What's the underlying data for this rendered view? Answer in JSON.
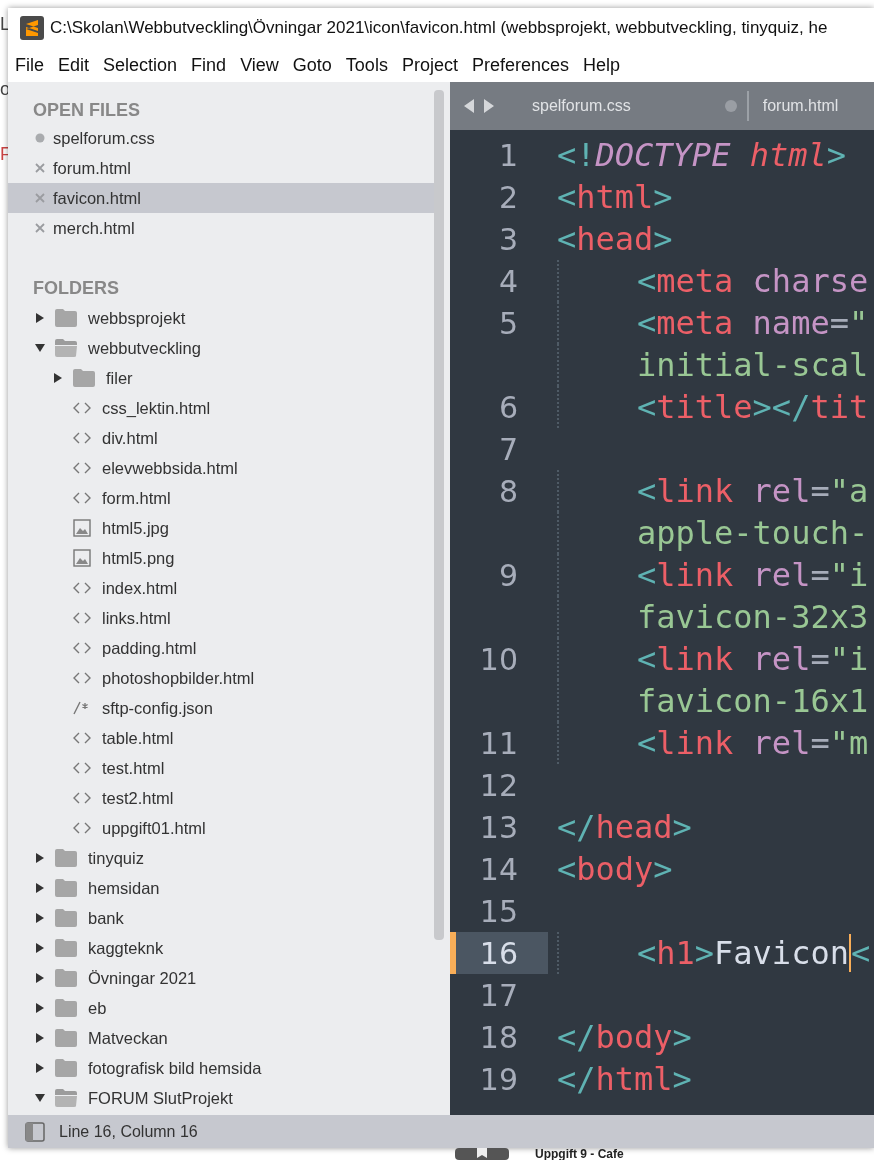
{
  "background": {
    "fragments": [
      "L",
      "o",
      "F"
    ],
    "behind_text": "Uppgift 9 - Cafe"
  },
  "window": {
    "title": "C:\\Skolan\\Webbutveckling\\Övningar 2021\\icon\\favicon.html (webbsprojekt, webbutveckling, tinyquiz, he"
  },
  "menu": [
    "File",
    "Edit",
    "Selection",
    "Find",
    "View",
    "Goto",
    "Tools",
    "Project",
    "Preferences",
    "Help"
  ],
  "sidebar": {
    "open_files_heading": "OPEN FILES",
    "open_files": [
      {
        "name": "spelforum.css",
        "modified": true,
        "selected": false
      },
      {
        "name": "forum.html",
        "modified": false,
        "selected": false
      },
      {
        "name": "favicon.html",
        "modified": false,
        "selected": true
      },
      {
        "name": "merch.html",
        "modified": false,
        "selected": false
      }
    ],
    "folders_heading": "FOLDERS",
    "folders": [
      {
        "name": "webbsprojekt",
        "kind": "folder",
        "expanded": false
      },
      {
        "name": "webbutveckling",
        "kind": "folder",
        "expanded": true,
        "children": [
          {
            "name": "filer",
            "kind": "folder",
            "expanded": false
          },
          {
            "name": "css_lektin.html",
            "kind": "code"
          },
          {
            "name": "div.html",
            "kind": "code"
          },
          {
            "name": "elevwebbsida.html",
            "kind": "code"
          },
          {
            "name": "form.html",
            "kind": "code"
          },
          {
            "name": "html5.jpg",
            "kind": "image"
          },
          {
            "name": "html5.png",
            "kind": "image"
          },
          {
            "name": "index.html",
            "kind": "code"
          },
          {
            "name": "links.html",
            "kind": "code"
          },
          {
            "name": "padding.html",
            "kind": "code"
          },
          {
            "name": "photoshopbilder.html",
            "kind": "code"
          },
          {
            "name": "sftp-config.json",
            "kind": "json"
          },
          {
            "name": "table.html",
            "kind": "code"
          },
          {
            "name": "test.html",
            "kind": "code"
          },
          {
            "name": "test2.html",
            "kind": "code"
          },
          {
            "name": "uppgift01.html",
            "kind": "code"
          }
        ]
      },
      {
        "name": "tinyquiz",
        "kind": "folder",
        "expanded": false
      },
      {
        "name": "hemsidan",
        "kind": "folder",
        "expanded": false
      },
      {
        "name": "bank",
        "kind": "folder",
        "expanded": false
      },
      {
        "name": "kaggteknk",
        "kind": "folder",
        "expanded": false
      },
      {
        "name": "Övningar 2021",
        "kind": "folder",
        "expanded": false
      },
      {
        "name": "eb",
        "kind": "folder",
        "expanded": false
      },
      {
        "name": "Matveckan",
        "kind": "folder",
        "expanded": false
      },
      {
        "name": "fotografisk bild hemsida",
        "kind": "folder",
        "expanded": false
      },
      {
        "name": "FORUM SlutProjekt",
        "kind": "folder",
        "expanded": true
      }
    ]
  },
  "tabs": [
    {
      "name": "spelforum.css",
      "modified": true
    },
    {
      "name": "forum.html",
      "modified": false
    }
  ],
  "editor": {
    "lines": [
      {
        "number": "1",
        "indented": false,
        "current": false,
        "segments": [
          {
            "text": "<!",
            "kind": "punct"
          },
          {
            "text": "DOCTYPE",
            "kind": "doctype"
          },
          {
            "text": " html",
            "kind": "doctype_name"
          },
          {
            "text": ">",
            "kind": "punct"
          }
        ]
      },
      {
        "number": "2",
        "indented": false,
        "current": false,
        "segments": [
          {
            "text": "<",
            "kind": "punct"
          },
          {
            "text": "html",
            "kind": "tag"
          },
          {
            "text": ">",
            "kind": "punct"
          }
        ]
      },
      {
        "number": "3",
        "indented": false,
        "current": false,
        "segments": [
          {
            "text": "<",
            "kind": "punct"
          },
          {
            "text": "head",
            "kind": "tag"
          },
          {
            "text": ">",
            "kind": "punct"
          }
        ]
      },
      {
        "number": "4",
        "indented": true,
        "current": false,
        "segments": [
          {
            "text": "<",
            "kind": "punct"
          },
          {
            "text": "meta",
            "kind": "tag"
          },
          {
            "text": " charse",
            "kind": "attr"
          }
        ]
      },
      {
        "number": "5",
        "indented": true,
        "current": false,
        "segments": [
          {
            "text": "<",
            "kind": "punct"
          },
          {
            "text": "meta",
            "kind": "tag"
          },
          {
            "text": " name",
            "kind": "attr"
          },
          {
            "text": "=",
            "kind": "op"
          },
          {
            "text": "\"",
            "kind": "string"
          }
        ]
      },
      {
        "indented": true,
        "current": false,
        "segments": [
          {
            "text": "initial-scal",
            "kind": "string"
          }
        ]
      },
      {
        "number": "6",
        "indented": true,
        "current": false,
        "segments": [
          {
            "text": "<",
            "kind": "punct"
          },
          {
            "text": "title",
            "kind": "tag"
          },
          {
            "text": "></",
            "kind": "punct"
          },
          {
            "text": "tit",
            "kind": "tag"
          }
        ]
      },
      {
        "number": "7",
        "indented": false,
        "current": false
      },
      {
        "number": "8",
        "indented": true,
        "current": false,
        "segments": [
          {
            "text": "<",
            "kind": "punct"
          },
          {
            "text": "link",
            "kind": "tag"
          },
          {
            "text": " rel",
            "kind": "attr"
          },
          {
            "text": "=",
            "kind": "op"
          },
          {
            "text": "\"a",
            "kind": "string"
          }
        ]
      },
      {
        "indented": true,
        "current": false,
        "segments": [
          {
            "text": "apple-touch-",
            "kind": "string"
          }
        ]
      },
      {
        "number": "9",
        "indented": true,
        "current": false,
        "segments": [
          {
            "text": "<",
            "kind": "punct"
          },
          {
            "text": "link",
            "kind": "tag"
          },
          {
            "text": " rel",
            "kind": "attr"
          },
          {
            "text": "=",
            "kind": "op"
          },
          {
            "text": "\"i",
            "kind": "string"
          }
        ]
      },
      {
        "indented": true,
        "current": false,
        "segments": [
          {
            "text": "favicon-32x3",
            "kind": "string"
          }
        ]
      },
      {
        "number": "10",
        "indented": true,
        "current": false,
        "segments": [
          {
            "text": "<",
            "kind": "punct"
          },
          {
            "text": "link",
            "kind": "tag"
          },
          {
            "text": " rel",
            "kind": "attr"
          },
          {
            "text": "=",
            "kind": "op"
          },
          {
            "text": "\"i",
            "kind": "string"
          }
        ]
      },
      {
        "indented": true,
        "current": false,
        "segments": [
          {
            "text": "favicon-16x1",
            "kind": "string"
          }
        ]
      },
      {
        "number": "11",
        "indented": true,
        "current": false,
        "segments": [
          {
            "text": "<",
            "kind": "punct"
          },
          {
            "text": "link",
            "kind": "tag"
          },
          {
            "text": " rel",
            "kind": "attr"
          },
          {
            "text": "=",
            "kind": "op"
          },
          {
            "text": "\"m",
            "kind": "string"
          }
        ]
      },
      {
        "number": "12",
        "indented": false,
        "current": false
      },
      {
        "number": "13",
        "indented": false,
        "current": false,
        "segments": [
          {
            "text": "</",
            "kind": "punct"
          },
          {
            "text": "head",
            "kind": "tag"
          },
          {
            "text": ">",
            "kind": "punct"
          }
        ]
      },
      {
        "number": "14",
        "indented": false,
        "current": false,
        "segments": [
          {
            "text": "<",
            "kind": "punct"
          },
          {
            "text": "body",
            "kind": "tag"
          },
          {
            "text": ">",
            "kind": "punct"
          }
        ]
      },
      {
        "number": "15",
        "indented": false,
        "current": false
      },
      {
        "number": "16",
        "indented": true,
        "current": true,
        "segments": [
          {
            "text": "<",
            "kind": "punct"
          },
          {
            "text": "h1",
            "kind": "tag"
          },
          {
            "text": ">",
            "kind": "punct"
          },
          {
            "text": "Favicon",
            "kind": "text"
          },
          {
            "text": "<",
            "kind": "punct"
          }
        ]
      },
      {
        "number": "17",
        "indented": false,
        "current": false
      },
      {
        "number": "18",
        "indented": false,
        "current": false,
        "segments": [
          {
            "text": "</",
            "kind": "punct"
          },
          {
            "text": "body",
            "kind": "tag"
          },
          {
            "text": ">",
            "kind": "punct"
          }
        ]
      },
      {
        "number": "19",
        "indented": false,
        "current": false,
        "segments": [
          {
            "text": "</",
            "kind": "punct"
          },
          {
            "text": "html",
            "kind": "tag"
          },
          {
            "text": ">",
            "kind": "punct"
          }
        ]
      }
    ]
  },
  "status_bar": {
    "text": "Line 16, Column 16"
  }
}
